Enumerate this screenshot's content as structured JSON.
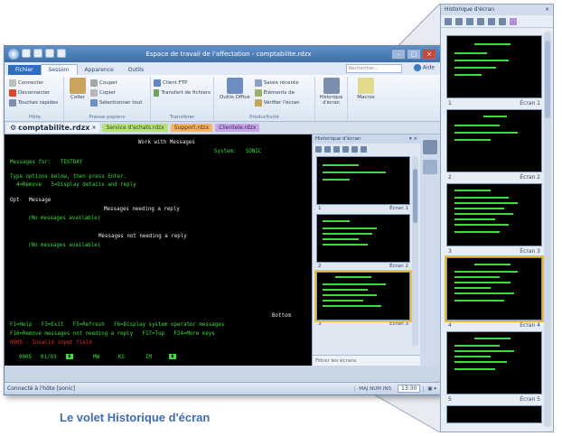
{
  "window": {
    "title": "Espace de travail de l'affectation - comptabilite.rdzx"
  },
  "ribbon": {
    "tabs": [
      {
        "label": "Fichier"
      },
      {
        "label": "Session"
      },
      {
        "label": "Apparence"
      },
      {
        "label": "Outils"
      }
    ],
    "search_placeholder": "Rechercher...",
    "help_label": "Aide",
    "groups": {
      "hote": {
        "label": "Hôte",
        "items": [
          "Connecter",
          "Déconnecter",
          "Touches rapides"
        ]
      },
      "presse": {
        "label": "Presse-papiers",
        "big": "Coller",
        "items": [
          "Couper",
          "Copier",
          "Sélectionner tout"
        ]
      },
      "transferer": {
        "label": "Transférer",
        "items": [
          "Client FTP",
          "Transfert de fichiers"
        ]
      },
      "productivite": {
        "label": "Productivité",
        "big": "Outils Office",
        "items": [
          "Saisie récente",
          "Éléments de",
          "Vérifier l'écran"
        ]
      },
      "extra": {
        "history": "Historique d'écran",
        "macros": "Macros"
      }
    }
  },
  "doc_tabs": [
    {
      "label": "comptabilite.rdzx"
    },
    {
      "label": "Service d'achats.rdzx"
    },
    {
      "label": "Support.rdzx"
    },
    {
      "label": "Clientele.rdzx"
    }
  ],
  "terminal": {
    "title": "Work with Messages",
    "system": "System:   SONIC",
    "messages_for": "Messages for:   TESTDAY",
    "instr1": "Type options below, then press Enter.",
    "instr2": "  4=Remove   5=Display details and reply",
    "col_header": "Opt   Message",
    "needing_header": "Messages needing a reply",
    "none1": "(No messages available)",
    "not_needing_header": "Messages not needing a reply",
    "none2": "(No messages available)",
    "bottom": "Bottom",
    "fkeys1": "F1=Help   F3=Exit   F5=Refresh   F6=Display system operator messages",
    "fkeys2": "F16=Remove messages not needing a reply   F17=Top   F24=More keys",
    "error": "0005 - Invalid input field",
    "statusline": [
      "0005",
      "01/03",
      "MW",
      "KS",
      "IM"
    ]
  },
  "history_panel": {
    "title": "Historique d'écran",
    "items": [
      {
        "num": "1",
        "label": "Écran 1"
      },
      {
        "num": "2",
        "label": "Écran 2"
      },
      {
        "num": "3",
        "label": "Écran 3"
      }
    ],
    "filter_placeholder": "Filtrer les écrans"
  },
  "statusbar": {
    "left": "Connecté à l'hôte [sonic]",
    "mode": "MAJ NUM INS",
    "time": "13:30"
  },
  "magnified": {
    "title": "Historique d'écran",
    "items": [
      {
        "num": "1",
        "label": "Écran 1"
      },
      {
        "num": "2",
        "label": "Écran 2"
      },
      {
        "num": "3",
        "label": "Écran 3"
      },
      {
        "num": "4",
        "label": "Écran 4"
      },
      {
        "num": "5",
        "label": "Écran 5"
      }
    ]
  },
  "caption": "Le volet Historique d'écran"
}
